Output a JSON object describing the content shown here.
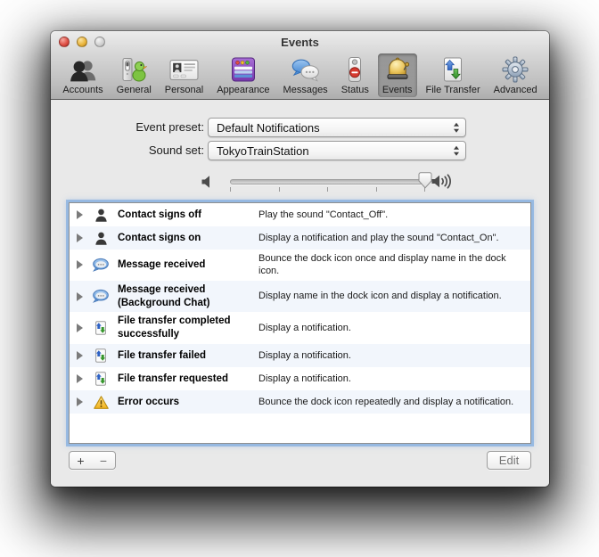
{
  "window": {
    "title": "Events",
    "traffic_lights": [
      "close",
      "minimize",
      "zoom"
    ]
  },
  "toolbar": {
    "items": [
      {
        "id": "accounts",
        "label": "Accounts",
        "icon": "accounts",
        "selected": false
      },
      {
        "id": "general",
        "label": "General",
        "icon": "general",
        "selected": false
      },
      {
        "id": "personal",
        "label": "Personal",
        "icon": "personal",
        "selected": false
      },
      {
        "id": "appearance",
        "label": "Appearance",
        "icon": "appearance",
        "selected": false
      },
      {
        "id": "messages",
        "label": "Messages",
        "icon": "messages",
        "selected": false
      },
      {
        "id": "status",
        "label": "Status",
        "icon": "status",
        "selected": false
      },
      {
        "id": "events",
        "label": "Events",
        "icon": "events",
        "selected": true
      },
      {
        "id": "file-transfer",
        "label": "File Transfer",
        "icon": "file-transfer-lg",
        "selected": false
      },
      {
        "id": "advanced",
        "label": "Advanced",
        "icon": "advanced",
        "selected": false
      }
    ]
  },
  "controls": {
    "event_preset": {
      "label": "Event preset:",
      "value": "Default Notifications"
    },
    "sound_set": {
      "label": "Sound set:",
      "value": "TokyoTrainStation"
    },
    "volume": {
      "value_pct": 100,
      "tick_count": 5,
      "min_icon": "speaker-low",
      "max_icon": "speaker-high"
    }
  },
  "event_list": {
    "rows": [
      {
        "id": "contact-signs-off",
        "icon": "person",
        "title": "Contact signs off",
        "description": "Play the sound \"Contact_Off\"."
      },
      {
        "id": "contact-signs-on",
        "icon": "person",
        "title": "Contact signs on",
        "description": "Display a notification and play the sound \"Contact_On\"."
      },
      {
        "id": "message-received",
        "icon": "chat",
        "title": "Message received",
        "description": "Bounce the dock icon once and display name in the dock icon."
      },
      {
        "id": "message-received-background-chat",
        "icon": "chat",
        "title": "Message received (Background Chat)",
        "description": "Display name in the dock icon and display a notification."
      },
      {
        "id": "file-transfer-completed",
        "icon": "file-transfer",
        "title": "File transfer completed successfully",
        "description": "Display a notification."
      },
      {
        "id": "file-transfer-failed",
        "icon": "file-transfer",
        "title": "File transfer failed",
        "description": "Display a notification."
      },
      {
        "id": "file-transfer-requested",
        "icon": "file-transfer",
        "title": "File transfer requested",
        "description": "Display a notification."
      },
      {
        "id": "error-occurs",
        "icon": "warning",
        "title": "Error occurs",
        "description": "Bounce the dock icon repeatedly and display a notification."
      }
    ]
  },
  "footer": {
    "add_label": "+",
    "remove_label": "−",
    "edit_label": "Edit"
  },
  "colors": {
    "focus_ring": "#78a7de",
    "row_alt": "#f2f6fc",
    "toolbar_selected_bg": "rgba(0,0,0,0.25)",
    "bell_gold": "#e8c25a",
    "warning_yellow": "#f5b61e",
    "status_red": "#d63a30"
  }
}
